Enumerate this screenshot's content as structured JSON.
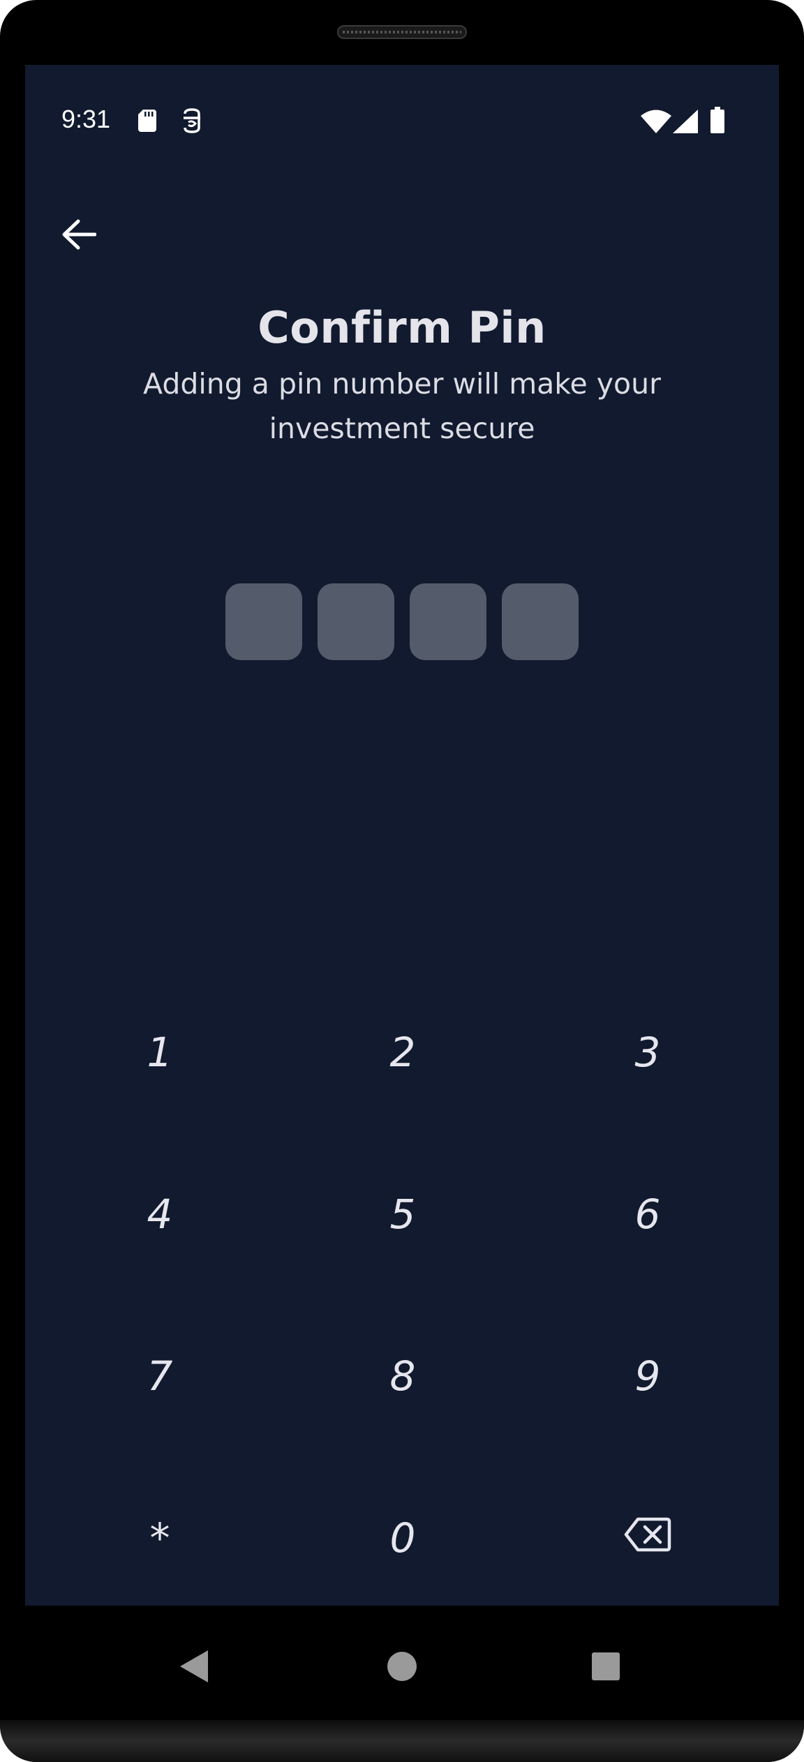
{
  "status_bar": {
    "time": "9:31",
    "left_icons": [
      "sd-card-icon",
      "accessibility-icon"
    ],
    "right_icons": [
      "wifi-icon",
      "cellular-signal-icon",
      "battery-icon"
    ]
  },
  "header": {
    "back_icon": "arrow-left-icon",
    "title": "Confirm Pin",
    "subtitle": "Adding a pin number will make your investment secure"
  },
  "pin": {
    "length": 4,
    "entered": 0,
    "box_color": "#545b6a"
  },
  "keypad": {
    "keys": [
      {
        "label": "1"
      },
      {
        "label": "2"
      },
      {
        "label": "3"
      },
      {
        "label": "4"
      },
      {
        "label": "5"
      },
      {
        "label": "6"
      },
      {
        "label": "7"
      },
      {
        "label": "8"
      },
      {
        "label": "9"
      },
      {
        "label": "*"
      },
      {
        "label": "0"
      },
      {
        "label": "",
        "icon": "backspace-icon"
      }
    ]
  },
  "nav_bar": {
    "buttons": [
      "back-triangle-icon",
      "home-circle-icon",
      "recents-square-icon"
    ]
  },
  "colors": {
    "background": "#111a2e",
    "text": "#e4e4ea",
    "pin_box": "#545b6a"
  }
}
